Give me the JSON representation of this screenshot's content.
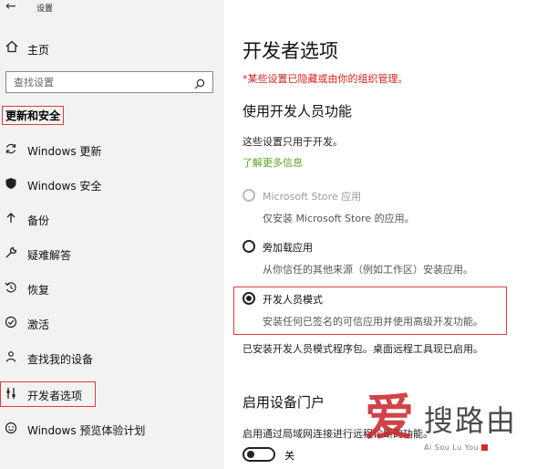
{
  "window": {
    "title": "设置"
  },
  "sidebar": {
    "home_label": "主页",
    "search_placeholder": "查找设置",
    "section_title": "更新和安全",
    "items": [
      {
        "label": "Windows 更新",
        "icon": "sync-icon"
      },
      {
        "label": "Windows 安全",
        "icon": "shield-icon"
      },
      {
        "label": "备份",
        "icon": "backup-arrow-icon"
      },
      {
        "label": "疑难解答",
        "icon": "wrench-icon"
      },
      {
        "label": "恢复",
        "icon": "recovery-icon"
      },
      {
        "label": "激活",
        "icon": "check-circle-icon"
      },
      {
        "label": "查找我的设备",
        "icon": "person-pin-icon"
      },
      {
        "label": "开发者选项",
        "icon": "developer-tools-icon"
      },
      {
        "label": "Windows 预览体验计划",
        "icon": "smiley-icon"
      }
    ],
    "active_item": "开发者选项"
  },
  "main": {
    "title": "开发者选项",
    "managed_note": "*某些设置已隐藏或由你的组织管理。",
    "dev_features": {
      "title": "使用开发人员功能",
      "desc": "这些设置只用于开发。",
      "learn_more": "了解更多信息",
      "options": [
        {
          "label": "Microsoft Store 应用",
          "desc": "仅安装 Microsoft Store 的应用。",
          "state": "disabled"
        },
        {
          "label": "旁加载应用",
          "desc": "从你信任的其他来源（例如工作区）安装应用。",
          "state": "unchecked"
        },
        {
          "label": "开发人员模式",
          "desc": "安装任何已签名的可信应用并使用高级开发功能。",
          "state": "checked"
        }
      ],
      "installed_note": "已安装开发人员模式程序包。桌面远程工具现已启用。"
    },
    "device_portal": {
      "title": "启用设备门户",
      "desc": "启用通过局域网连接进行远程诊断的功能。",
      "toggle_label": "关",
      "toggle_state": "off"
    }
  },
  "watermark": {
    "seal_char": "爱",
    "chars": "搜路由",
    "sub": "Ai Sou Lu You"
  },
  "colors": {
    "highlight_box": "#e03c3c",
    "managed_note": "#d81f1f",
    "link": "#5aa31b",
    "sidebar_bg": "#f2f2f2"
  }
}
